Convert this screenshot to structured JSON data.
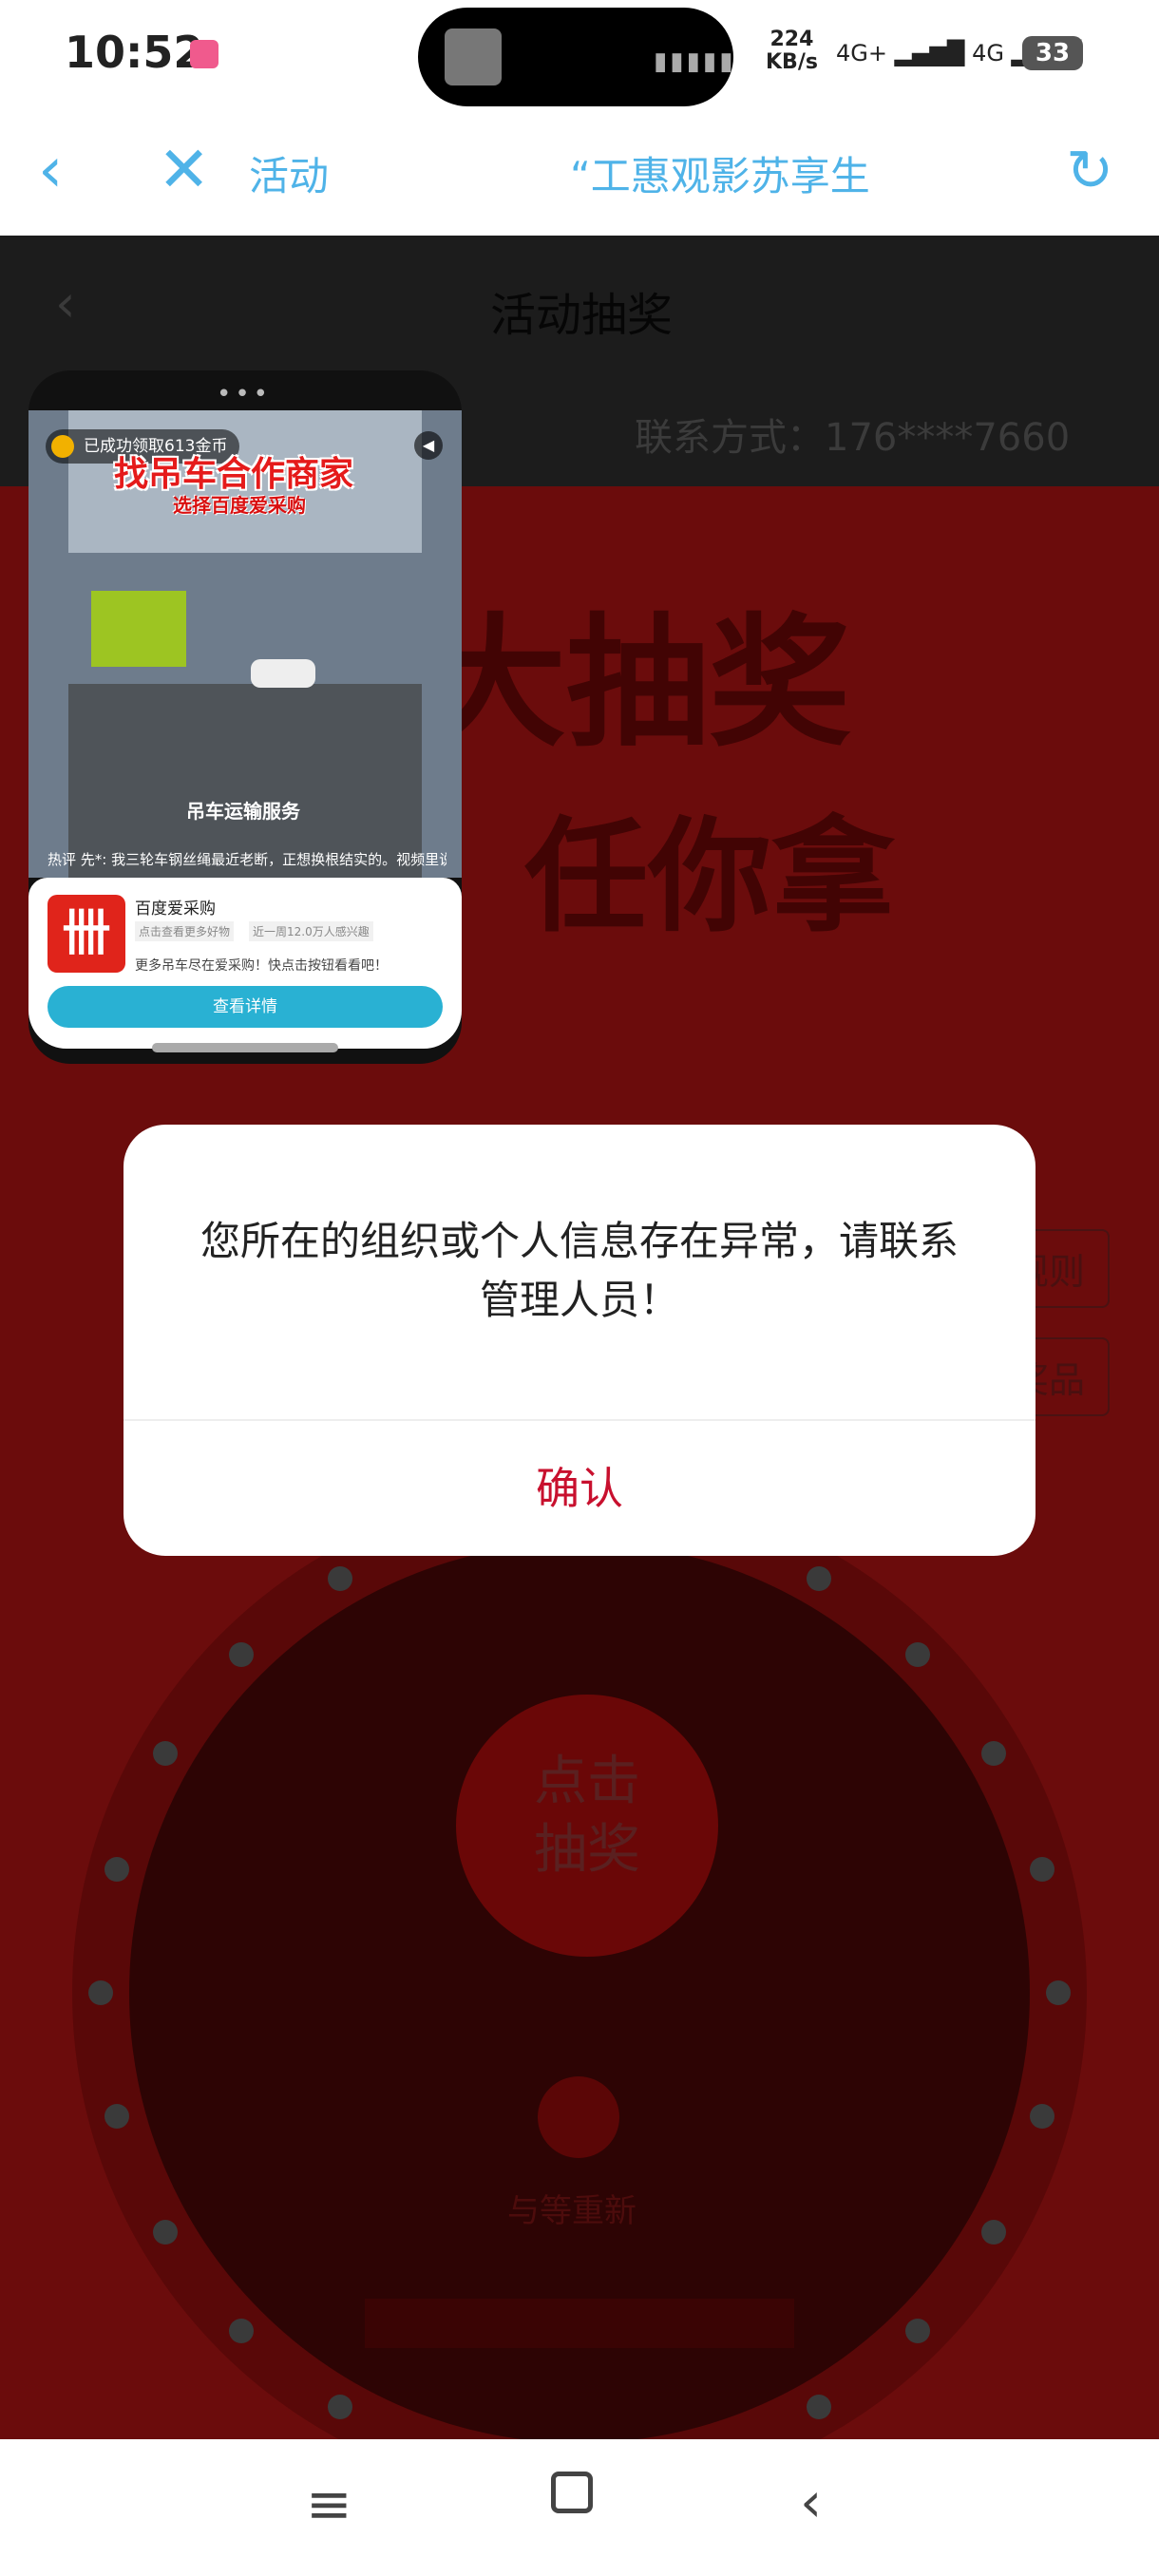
{
  "status_bar": {
    "time": "10:52",
    "net_speed": "224\nKB/s",
    "signal": "4G+ ▂▄▆█ 4G ▂▄▆█",
    "battery": "33"
  },
  "toolbar": {
    "title_left": "活动",
    "title_main": "“工惠观影苏享生",
    "back_icon": "chevron-left",
    "close_icon": "close",
    "refresh_icon": "refresh"
  },
  "page": {
    "header_title": "活动抽奖",
    "contact": "联系方式：176****7660",
    "banner_line_1": "大抽奖",
    "banner_line_2": "任你拿",
    "rules_btn": "规则",
    "prizes_btn": "奖品",
    "wheel_button": "点击\n抽奖",
    "wait_text": "与等重新"
  },
  "ad": {
    "coin_text": "已成功领取613金币",
    "headline": "找吊车合作商家",
    "subline": "选择百度爱采购",
    "video_caption": "吊车运输服务",
    "hot_comment": "热评  先*: 我三轮车钢丝绳最近老断，正想换根结实的。视频里说卖…",
    "brand": "百度爱采购",
    "tag_1": "点击查看更多好物",
    "tag_2": "近一周12.0万人感兴趣",
    "description": "更多吊车尽在爱采购！快点击按钮看看吧！",
    "cta": "查看详情",
    "logo_glyph": "卌"
  },
  "dialog": {
    "message": "您所在的组织或个人信息存在异常，请联系管理人员！",
    "confirm": "确认"
  },
  "nav": {
    "menu": "≡",
    "home": "□",
    "back": "‹"
  }
}
